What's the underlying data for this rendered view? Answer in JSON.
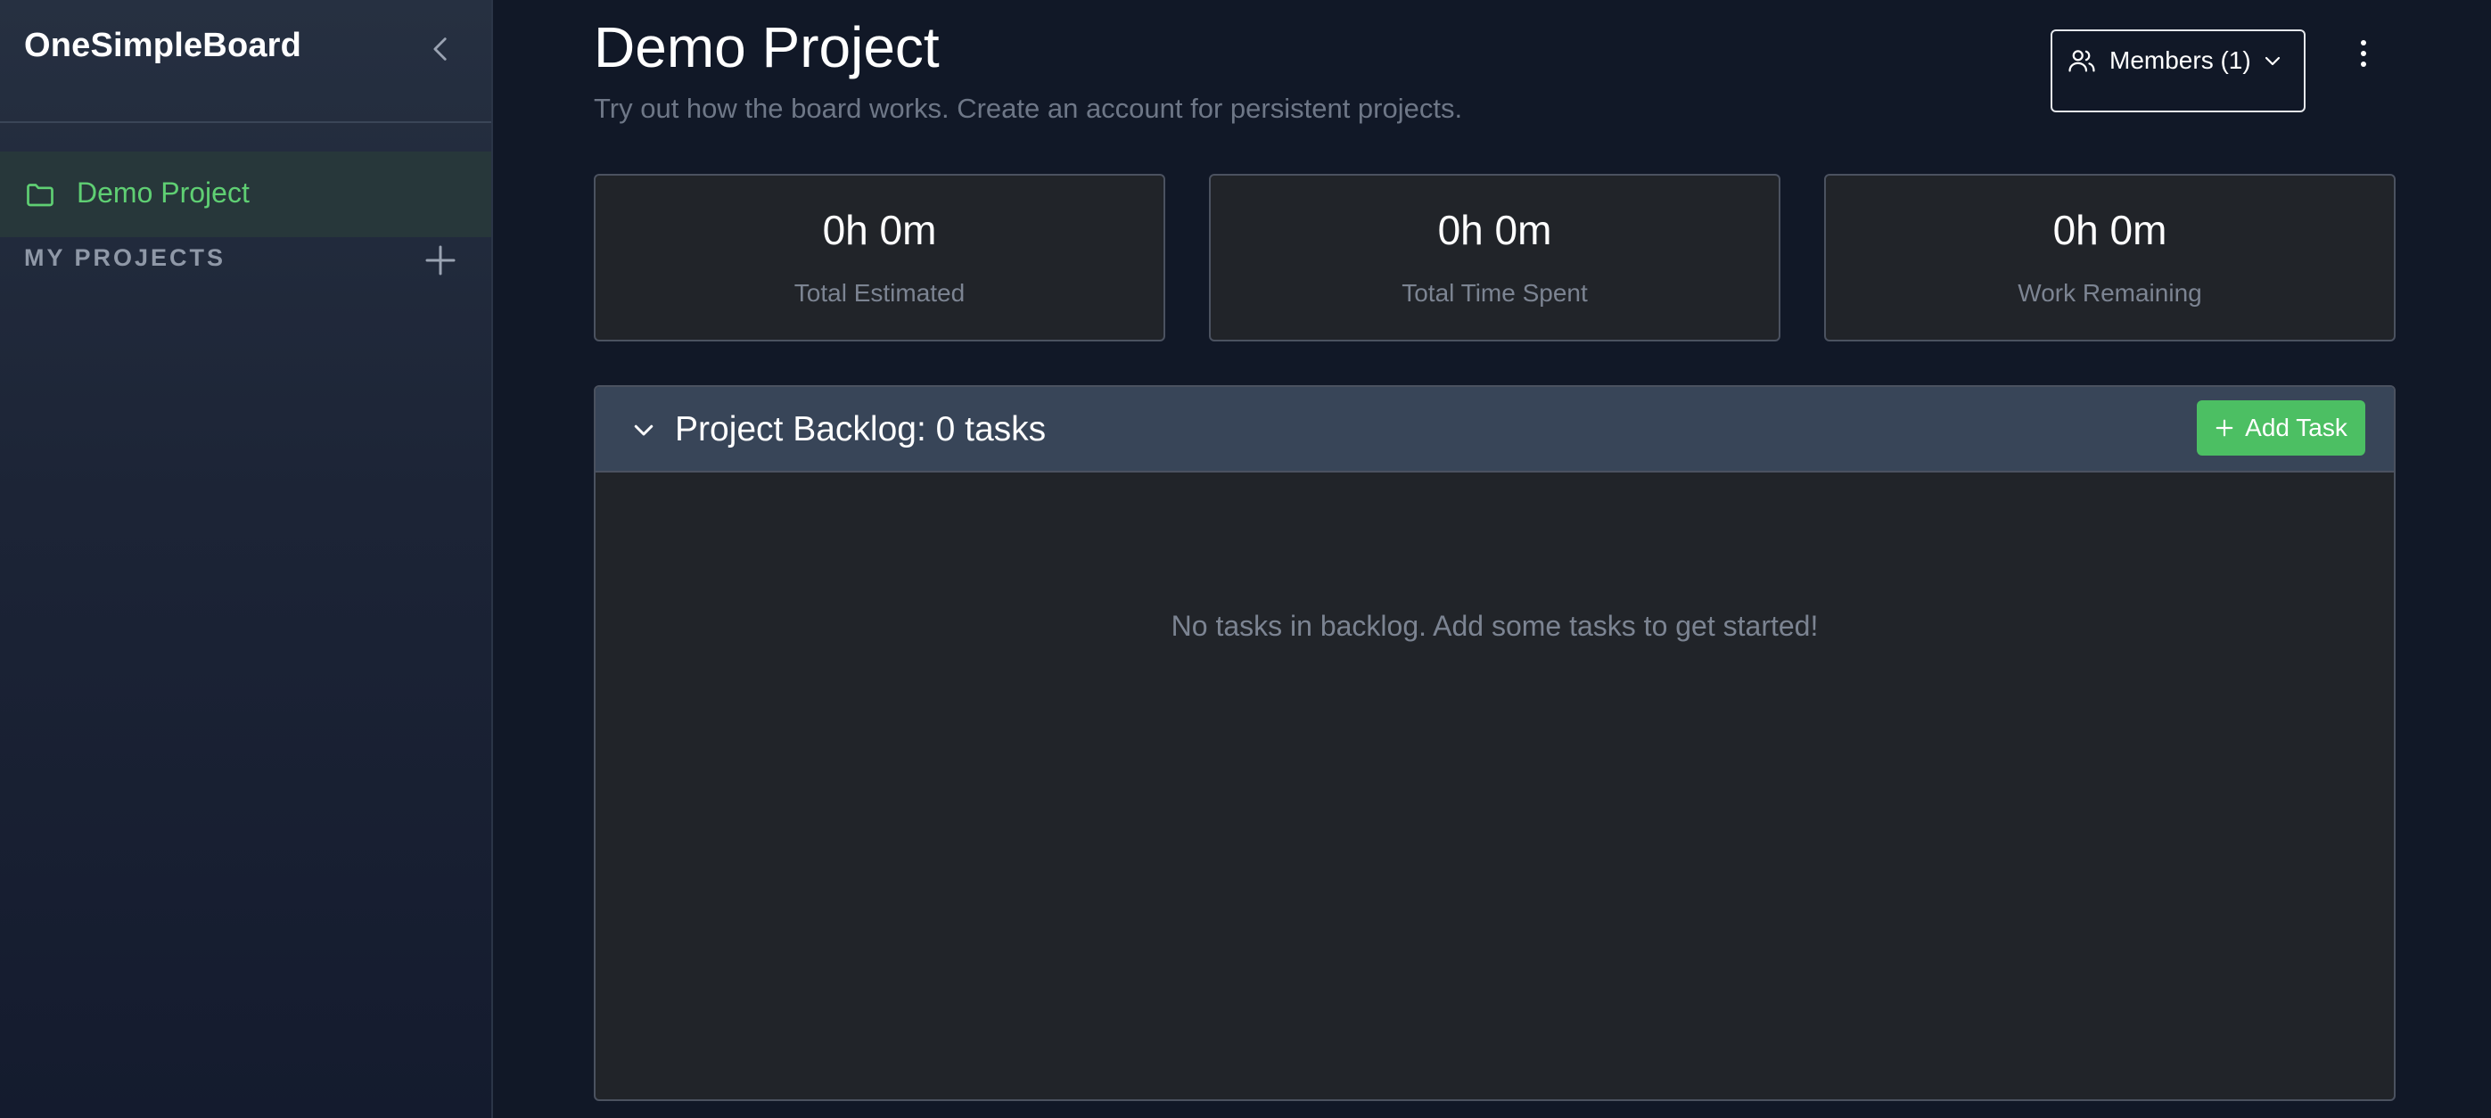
{
  "sidebar": {
    "brand": "OneSimpleBoard",
    "active_project": "Demo Project",
    "section_label": "MY PROJECTS"
  },
  "header": {
    "title": "Demo Project",
    "subtitle": "Try out how the board works. Create an account for persistent projects.",
    "members_label": "Members (1)"
  },
  "stats": [
    {
      "value": "0h 0m",
      "label": "Total Estimated"
    },
    {
      "value": "0h 0m",
      "label": "Total Time Spent"
    },
    {
      "value": "0h 0m",
      "label": "Work Remaining"
    }
  ],
  "backlog": {
    "title": "Project Backlog: 0 tasks",
    "add_task_label": "Add Task",
    "empty_message": "No tasks in backlog. Add some tasks to get started!"
  },
  "colors": {
    "accent_green": "#4cbf63",
    "active_text_green": "#5fcf73",
    "background": "#111827",
    "card_background": "#212429",
    "header_background": "#384558"
  },
  "icons": {
    "collapse": "chevron-left-icon",
    "folder": "folder-icon",
    "add_project": "plus-icon",
    "members": "users-icon",
    "members_dropdown": "chevron-down-icon",
    "more": "kebab-icon",
    "backlog_toggle": "chevron-down-icon",
    "add_task": "plus-icon"
  }
}
